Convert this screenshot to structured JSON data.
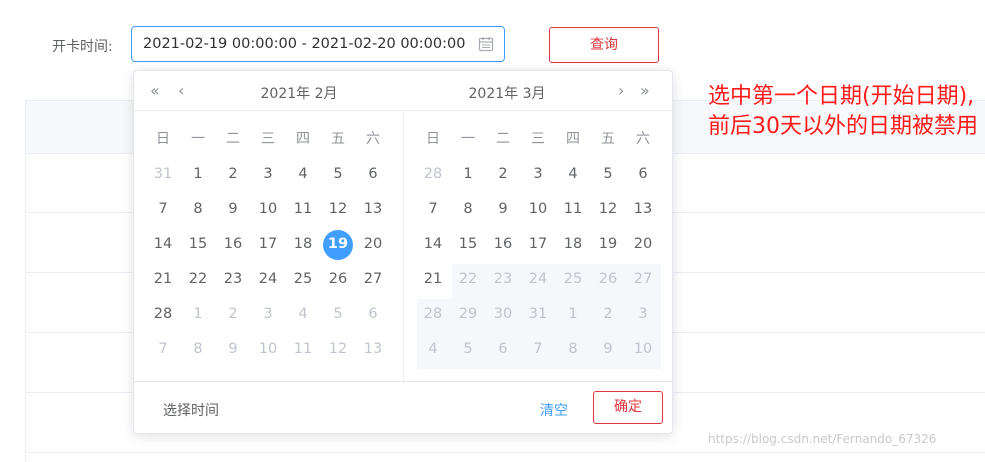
{
  "form": {
    "label": "开卡时间:",
    "range_value": "2021-02-19 00:00:00 - 2021-02-20 00:00:00",
    "query_button": "查询"
  },
  "picker": {
    "left_title": "2021年 2月",
    "right_title": "2021年 3月",
    "nav": {
      "prev_year": "«",
      "prev_month": "‹",
      "next_month": "›",
      "next_year": "»"
    },
    "weekdays": [
      "日",
      "一",
      "二",
      "三",
      "四",
      "五",
      "六"
    ],
    "left_days": [
      [
        "31",
        "1",
        "2",
        "3",
        "4",
        "5",
        "6"
      ],
      [
        "7",
        "8",
        "9",
        "10",
        "11",
        "12",
        "13"
      ],
      [
        "14",
        "15",
        "16",
        "17",
        "18",
        "19",
        "20"
      ],
      [
        "21",
        "22",
        "23",
        "24",
        "25",
        "26",
        "27"
      ],
      [
        "28",
        "1",
        "2",
        "3",
        "4",
        "5",
        "6"
      ],
      [
        "7",
        "8",
        "9",
        "10",
        "11",
        "12",
        "13"
      ]
    ],
    "right_days": [
      [
        "28",
        "1",
        "2",
        "3",
        "4",
        "5",
        "6"
      ],
      [
        "7",
        "8",
        "9",
        "10",
        "11",
        "12",
        "13"
      ],
      [
        "14",
        "15",
        "16",
        "17",
        "18",
        "19",
        "20"
      ],
      [
        "21",
        "22",
        "23",
        "24",
        "25",
        "26",
        "27"
      ],
      [
        "28",
        "29",
        "30",
        "31",
        "1",
        "2",
        "3"
      ],
      [
        "4",
        "5",
        "6",
        "7",
        "8",
        "9",
        "10"
      ]
    ],
    "selected_day": "19",
    "footer_label": "选择时间",
    "clear_button": "清空",
    "confirm_button": "确定"
  },
  "annotation": "选中第一个日期(开始日期),前后30天以外的日期被禁用",
  "watermark": "https://blog.csdn.net/Fernando_67326",
  "colors": {
    "primary": "#409eff",
    "danger": "#e0383e",
    "annotation": "#ff1a1a"
  }
}
